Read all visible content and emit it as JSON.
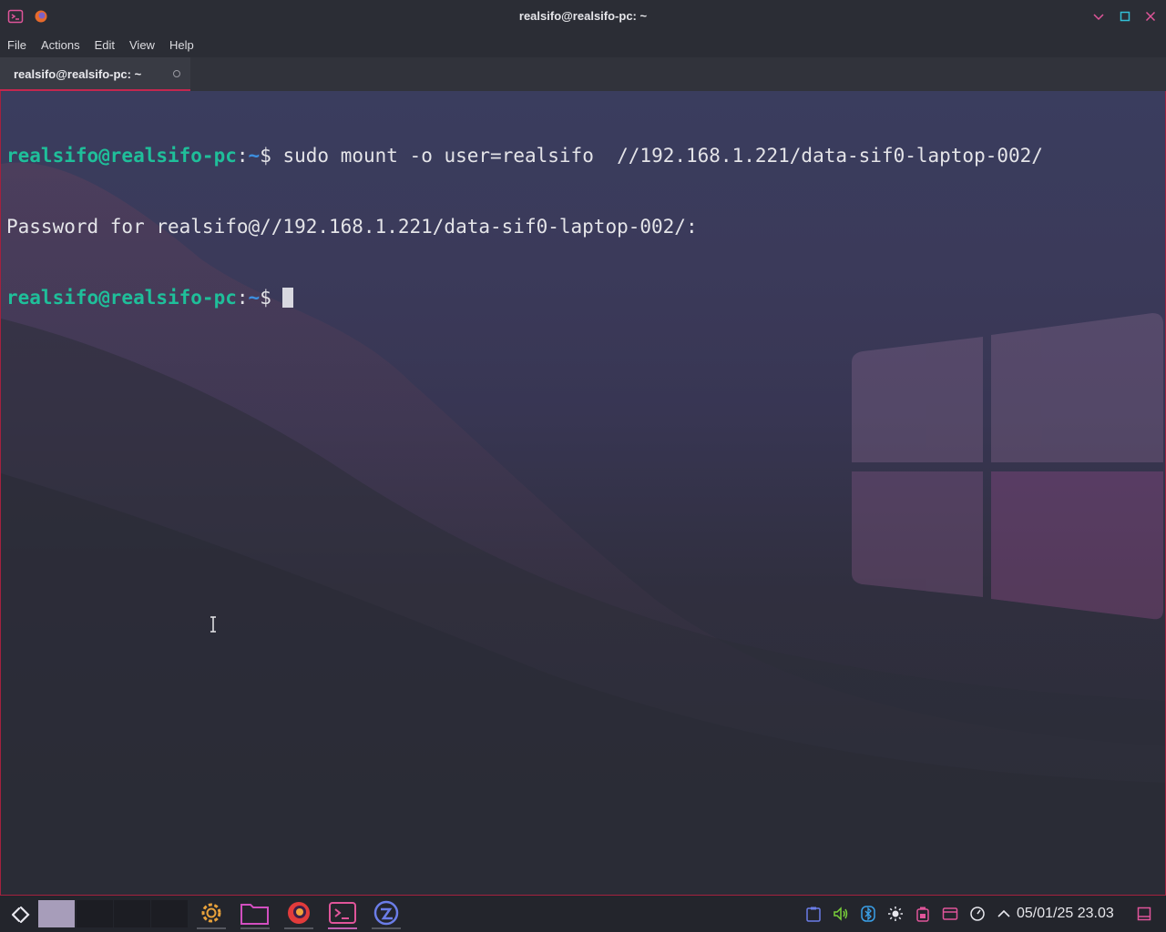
{
  "window": {
    "title": "realsifo@realsifo-pc: ~",
    "app_icon": "konsole-icon",
    "controls": [
      "minimize-icon",
      "maximize-icon",
      "close-icon"
    ]
  },
  "menu": {
    "items": [
      "File",
      "Actions",
      "Edit",
      "View",
      "Help"
    ]
  },
  "tabs": [
    {
      "label": "realsifo@realsifo-pc: ~",
      "active": true
    }
  ],
  "terminal": {
    "lines": [
      {
        "user": "realsifo@realsifo-pc",
        "sep": ":",
        "path": "~",
        "prompt": "$ ",
        "command": "sudo mount -o user=realsifo  //192.168.1.221/data-sif0-laptop-002/"
      },
      {
        "output": "Password for realsifo@//192.168.1.221/data-sif0-laptop-002/:"
      },
      {
        "user": "realsifo@realsifo-pc",
        "sep": ":",
        "path": "~",
        "prompt": "$ ",
        "command": ""
      }
    ]
  },
  "taskbar": {
    "launcher_icon": "application-launcher-icon",
    "desktops": [
      {
        "active": true
      },
      {
        "active": false
      },
      {
        "active": false
      },
      {
        "active": false
      }
    ],
    "apps": [
      {
        "name": "settings-icon",
        "active": false
      },
      {
        "name": "folder-icon",
        "active": false
      },
      {
        "name": "browser-icon",
        "active": false
      },
      {
        "name": "terminal-icon",
        "active": true
      },
      {
        "name": "app-store-icon",
        "active": false
      }
    ],
    "tray": [
      "clipboard-icon",
      "volume-icon",
      "bluetooth-icon",
      "brightness-icon",
      "battery-icon",
      "network-icon",
      "performance-icon",
      "chevron-up-icon"
    ],
    "clock": "05/01/25 23.03"
  },
  "colors": {
    "accent": "#c3274f",
    "prompt_user": "#1fbf9a",
    "prompt_path": "#3d8fe0"
  }
}
